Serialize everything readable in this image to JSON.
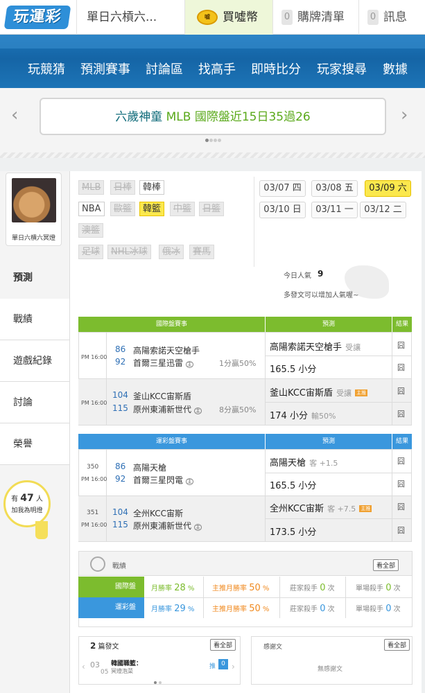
{
  "top": {
    "logo": "玩運彩",
    "user_tab": "單日六槓六...",
    "coin_icon": "嘘",
    "buy_coin": "買噓幣",
    "cart_count": "0",
    "cart_label": "購牌清單",
    "msg_count": "0",
    "msg_label": "訊息"
  },
  "nav": [
    "玩競猜",
    "預測賽事",
    "討論區",
    "找高手",
    "即時比分",
    "玩家搜尋",
    "數據"
  ],
  "banner": {
    "prefix": "六歲神童",
    "highlight": "MLB 國際盤近15日35過26",
    "prev": "‹",
    "next": "›"
  },
  "sidebar": {
    "name": "單日六槓六冥燈",
    "tabs": [
      "預測",
      "戰績",
      "遊戲紀錄",
      "討論",
      "榮譽"
    ],
    "fans_prefix": "有",
    "fans_count": "47",
    "fans_suffix": "人",
    "fans_cta": "加我為明燈"
  },
  "categories": [
    {
      "label": "MLB",
      "state": "off"
    },
    {
      "label": "日棒",
      "state": "off"
    },
    {
      "label": "韓棒",
      "state": "on"
    },
    {
      "label": "NBA",
      "state": "on"
    },
    {
      "label": "歐籃",
      "state": "off"
    },
    {
      "label": "韓籃",
      "state": "selected"
    },
    {
      "label": "中籃",
      "state": "off"
    },
    {
      "label": "日籃",
      "state": "off"
    },
    {
      "label": "澳籃",
      "state": "off"
    },
    {
      "label": "足球",
      "state": "off"
    },
    {
      "label": "NHL冰球",
      "state": "off"
    },
    {
      "label": "俄冰",
      "state": "off"
    },
    {
      "label": "賽馬",
      "state": "off"
    }
  ],
  "dates": [
    {
      "label": "03/07 四",
      "selected": false
    },
    {
      "label": "03/08 五",
      "selected": false
    },
    {
      "label": "03/09 六",
      "selected": true
    },
    {
      "label": "03/10 日",
      "selected": false
    },
    {
      "label": "03/11 一",
      "selected": false
    },
    {
      "label": "03/12 二",
      "selected": false
    }
  ],
  "popularity": {
    "label": "今日人氣",
    "value": "9",
    "hint": "多發文可以增加人氣喔~"
  },
  "intl": {
    "headers": [
      "國際盤賽事",
      "預測",
      "結果"
    ],
    "color": "#7cbc2e",
    "games": [
      {
        "code": "",
        "time": "PM 16:00",
        "away_num": "86",
        "away": "高陽索諾天空槍手",
        "home_num": "92",
        "home": "首爾三星迅雷",
        "host": "主",
        "stat": "1分贏50%",
        "pred1": "高陽索諾天空槍手",
        "pred1_sub": "受讓",
        "pred1_chief": "",
        "pred2": "165.5 小分",
        "pred2_sub": "",
        "res1": "囧",
        "res2": "囧"
      },
      {
        "code": "",
        "time": "PM 16:00",
        "away_num": "104",
        "away": "釜山KCC宙斯盾",
        "home_num": "115",
        "home": "原州東浦新世代",
        "host": "主",
        "stat": "8分贏50%",
        "pred1": "釜山KCC宙斯盾",
        "pred1_sub": "受讓",
        "pred1_chief": "主推",
        "pred2": "174 小分",
        "pred2_sub": "輸50%",
        "res1": "囧",
        "res2": "囧"
      }
    ]
  },
  "sport": {
    "headers": [
      "運彩盤賽事",
      "預測",
      "結果"
    ],
    "color": "#3a97dd",
    "games": [
      {
        "code": "350",
        "time": "PM 16:00",
        "away_num": "86",
        "away": "高陽天槍",
        "home_num": "92",
        "home": "首爾三星閃電",
        "host": "主",
        "stat": "",
        "pred1": "高陽天槍",
        "pred1_sub": "客 +1.5",
        "pred1_chief": "",
        "pred2": "165.5 小分",
        "pred2_sub": "",
        "res1": "囧",
        "res2": "囧"
      },
      {
        "code": "351",
        "time": "PM 16:00",
        "away_num": "104",
        "away": "全州KCC宙斯",
        "home_num": "115",
        "home": "原州東浦新世代",
        "host": "主",
        "stat": "",
        "pred1": "全州KCC宙斯",
        "pred1_sub": "客 +7.5",
        "pred1_chief": "主推",
        "pred2": "173.5 小分",
        "pred2_sub": "",
        "res1": "囧",
        "res2": "囧"
      }
    ]
  },
  "record": {
    "title": "戰績",
    "view_all": "看全部",
    "rows": [
      {
        "label": "國際盤",
        "color": "#7cbc2e",
        "month_label": "月勝率",
        "month": "28",
        "chief_label": "主推月勝率",
        "chief": "50",
        "banker_label": "莊家殺手",
        "banker": "0",
        "single_label": "單場殺手",
        "single": "0"
      },
      {
        "label": "運彩盤",
        "color": "#3a97dd",
        "month_label": "月勝率",
        "month": "29",
        "chief_label": "主推月勝率",
        "chief": "50",
        "banker_label": "莊家殺手",
        "banker": "0",
        "single_label": "單場殺手",
        "single": "0"
      }
    ],
    "pct": "%",
    "times": "次"
  },
  "posts": {
    "count": "2",
    "label": "篇發文",
    "view_all": "看全部",
    "month": "03",
    "day": "05",
    "title": "韓國職籃：",
    "author": "冥燈泡菜",
    "push_label": "推",
    "push": "0"
  },
  "thanks": {
    "label": "感謝文",
    "view_all": "看全部",
    "empty": "無感謝文"
  }
}
